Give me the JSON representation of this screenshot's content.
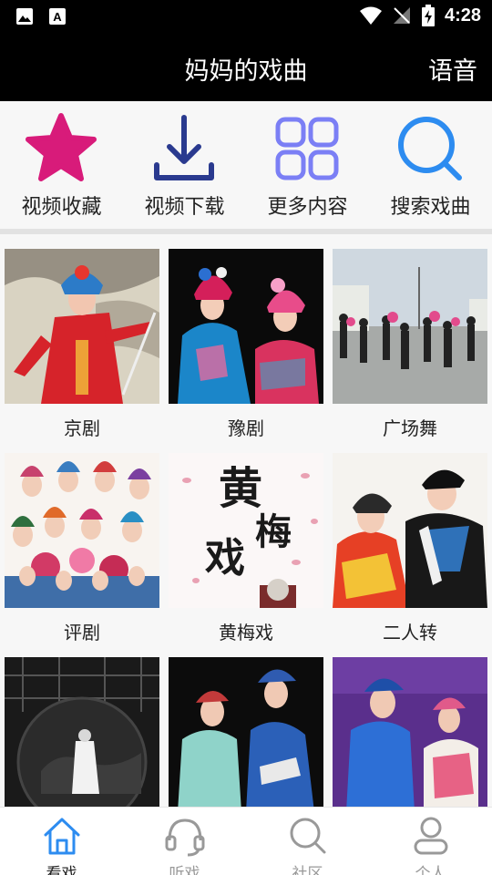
{
  "status_bar": {
    "time": "4:28"
  },
  "header": {
    "title": "妈妈的戏曲",
    "voice_label": "语音"
  },
  "quick_actions": [
    {
      "label": "视频收藏",
      "icon": "star-icon",
      "color": "#d81b7a"
    },
    {
      "label": "视频下载",
      "icon": "download-icon",
      "color": "#2a3a8f"
    },
    {
      "label": "更多内容",
      "icon": "grid-icon",
      "color": "#7b7ff5"
    },
    {
      "label": "搜索戏曲",
      "icon": "search-icon",
      "color": "#2d8cf0"
    }
  ],
  "categories": [
    {
      "label": "京剧"
    },
    {
      "label": "豫剧"
    },
    {
      "label": "广场舞"
    },
    {
      "label": "评剧"
    },
    {
      "label": "黄梅戏"
    },
    {
      "label": "二人转"
    },
    {
      "label": ""
    },
    {
      "label": ""
    },
    {
      "label": ""
    }
  ],
  "thumb_text": {
    "huangmeixi": "黄梅戏"
  },
  "bottom_nav": [
    {
      "label": "看戏",
      "icon": "home-icon",
      "active": true
    },
    {
      "label": "听戏",
      "icon": "headphones-icon",
      "active": false
    },
    {
      "label": "社区",
      "icon": "search-icon",
      "active": false
    },
    {
      "label": "个人",
      "icon": "user-icon",
      "active": false
    }
  ],
  "colors": {
    "active_nav": "#2d8cf0",
    "inactive_nav": "#999999",
    "header_bg": "#000000"
  }
}
